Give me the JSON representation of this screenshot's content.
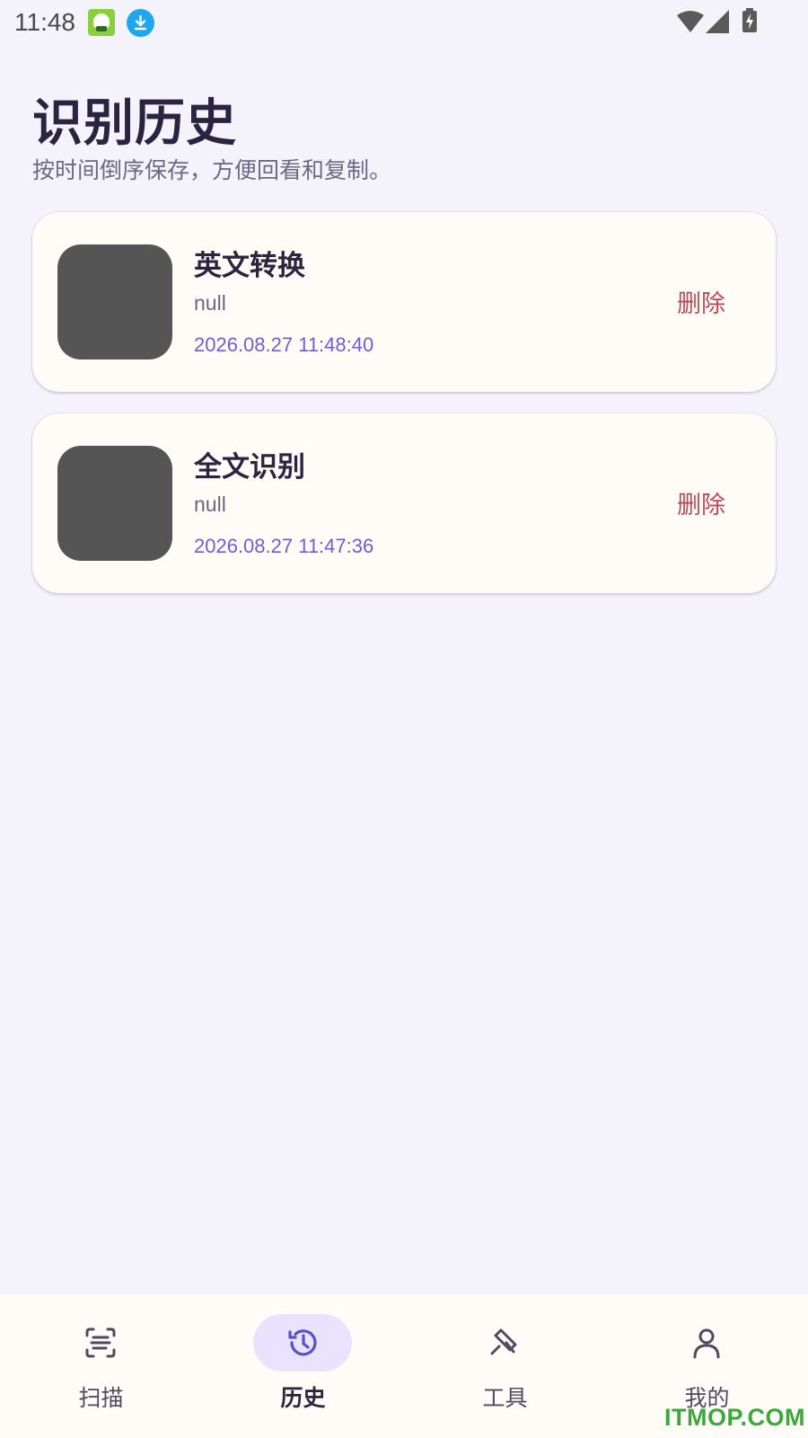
{
  "status_bar": {
    "time": "11:48"
  },
  "header": {
    "title": "识别历史",
    "subtitle": "按时间倒序保存，方便回看和复制。"
  },
  "history": [
    {
      "title": "英文转换",
      "text": "null",
      "time": "2026.08.27 11:48:40",
      "delete_label": "删除"
    },
    {
      "title": "全文识别",
      "text": "null",
      "time": "2026.08.27 11:47:36",
      "delete_label": "删除"
    }
  ],
  "nav": {
    "items": [
      {
        "label": "扫描",
        "icon": "scan-icon"
      },
      {
        "label": "历史",
        "icon": "history-icon",
        "active": true
      },
      {
        "label": "工具",
        "icon": "tool-icon"
      },
      {
        "label": "我的",
        "icon": "person-icon"
      }
    ]
  },
  "colors": {
    "accent": "#6d5fd6",
    "delete": "#c0485a",
    "background": "#f4f2fb",
    "card": "#fffbf7"
  },
  "watermark": "ITMOP.COM"
}
